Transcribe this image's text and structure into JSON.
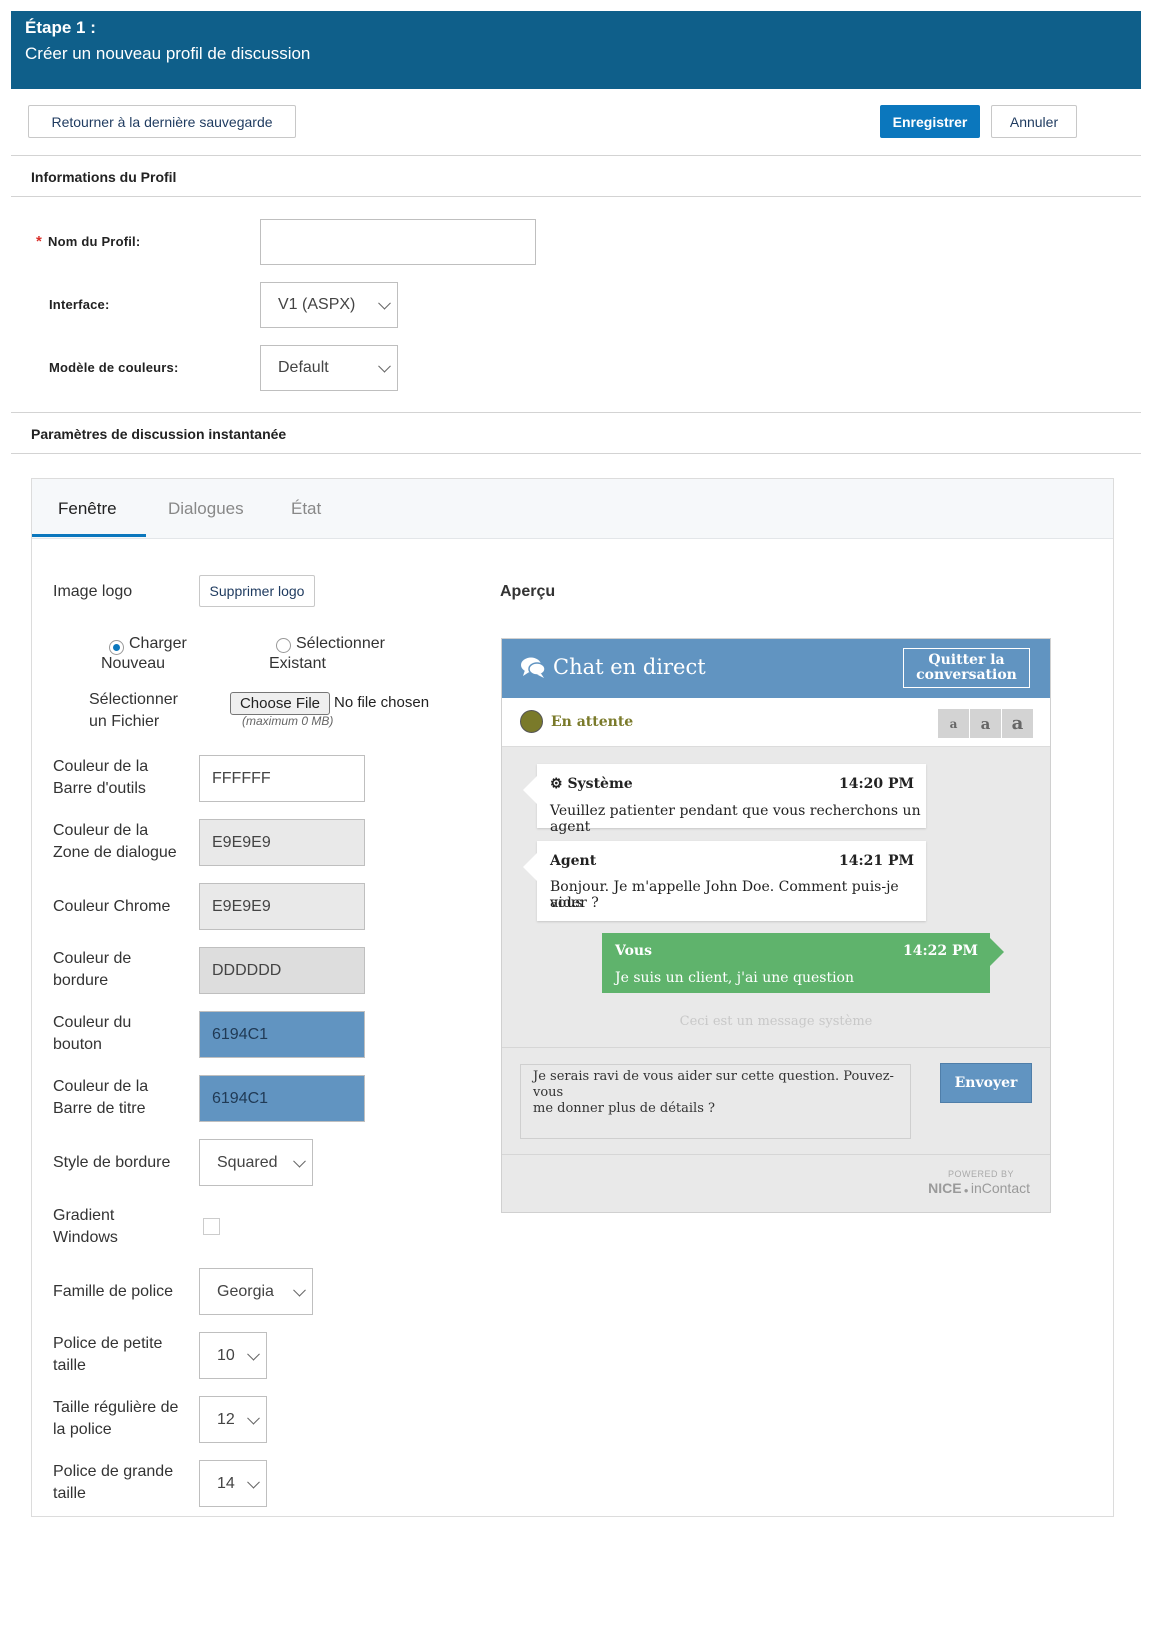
{
  "header": {
    "step": "Étape 1 :",
    "subtitle": "Créer un nouveau profil de discussion"
  },
  "toolbar": {
    "revert_label": "Retourner à la dernière sauvegarde",
    "save_label": "Enregistrer",
    "cancel_label": "Annuler"
  },
  "profile": {
    "section_title": "Informations du Profil",
    "name_label": "Nom du Profil:",
    "name_value": "",
    "interface_label": "Interface:",
    "interface_value": "V1 (ASPX)",
    "color_model_label": "Modèle de couleurs:",
    "color_model_value": "Default"
  },
  "instant": {
    "section_title": "Paramètres de discussion instantanée"
  },
  "tabs": [
    {
      "label": "Fenêtre",
      "active": true
    },
    {
      "label": "Dialogues",
      "active": false
    },
    {
      "label": "État",
      "active": false
    }
  ],
  "window": {
    "logo_label": "Image logo",
    "remove_logo_label": "Supprimer logo",
    "radio_upload_line1": "Charger",
    "radio_upload_line2": "Nouveau",
    "radio_select_line1": "Sélectionner",
    "radio_select_line2": "Existant",
    "file_label_line1": "Sélectionner",
    "file_label_line2": "un Fichier",
    "choose_file_label": "Choose File",
    "no_file_label": "No file chosen",
    "max_size": "(maximum 0 MB)",
    "toolbar_color_label_1": "Couleur de la",
    "toolbar_color_label_2": "Barre d'outils",
    "toolbar_color": "FFFFFF",
    "dialog_color_label_1": "Couleur de la",
    "dialog_color_label_2": "Zone de dialogue",
    "dialog_color": "E9E9E9",
    "chrome_color_label": "Couleur Chrome",
    "chrome_color": "E9E9E9",
    "border_color_label_1": "Couleur de",
    "border_color_label_2": "bordure",
    "border_color": "DDDDDD",
    "button_color_label_1": "Couleur du",
    "button_color_label_2": "bouton",
    "button_color": "6194C1",
    "titlebar_color_label_1": "Couleur de la",
    "titlebar_color_label_2": "Barre de titre",
    "titlebar_color": "6194C1",
    "border_style_label": "Style de bordure",
    "border_style_value": "Squared",
    "gradient_label_1": "Gradient",
    "gradient_label_2": "Windows",
    "font_family_label": "Famille de police",
    "font_family_value": "Georgia",
    "small_font_label_1": "Police de petite",
    "small_font_label_2": "taille",
    "small_font_value": "10",
    "regular_font_label_1": "Taille régulière de",
    "regular_font_label_2": "la police",
    "regular_font_value": "12",
    "large_font_label_1": "Police de grande",
    "large_font_label_2": "taille",
    "large_font_value": "14"
  },
  "preview": {
    "heading": "Aperçu",
    "title": "Chat en direct",
    "quit_line1": "Quitter la",
    "quit_line2": "conversation",
    "status": "En attente",
    "font_small": "a",
    "font_medium": "a",
    "font_large": "a",
    "messages": [
      {
        "sender": "Système",
        "time": "14:20 PM",
        "text": "Veuillez patienter pendant que vous recherchons un agent"
      },
      {
        "sender": "Agent",
        "time": "14:21 PM",
        "text_line1": "Bonjour. Je m'appelle John Doe. Comment puis-je vous",
        "text_line2": "aider ?"
      },
      {
        "sender": "Vous",
        "time": "14:22 PM",
        "text": "Je suis un client, j'ai une question"
      }
    ],
    "system_note": "Ceci est un message système",
    "input_line1": "Je serais ravi de vous aider sur cette question. Pouvez-vous",
    "input_line2": "me donner plus de détails ?",
    "send_label": "Envoyer",
    "powered_by": "POWERED BY",
    "brand_nice": "NICE",
    "brand_incontact": "inContact",
    "colors": {
      "titlebar": "#6194c1",
      "agent_msg": "#5fb36c",
      "status_dot": "#7a7a2a"
    }
  }
}
